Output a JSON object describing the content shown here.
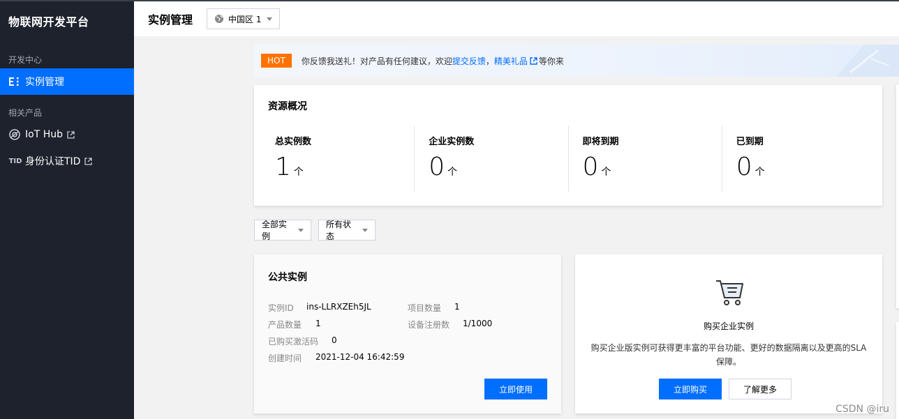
{
  "sidebar": {
    "brand": "物联网开发平台",
    "group1": "开发中心",
    "items": [
      {
        "label": "实例管理",
        "icon": "list-icon"
      }
    ],
    "group2": "相关产品",
    "related": [
      {
        "label": "IoT Hub",
        "icon": "iot-hub-icon"
      },
      {
        "label": "身份认证TID",
        "icon": "tid-icon",
        "icon_text": "TID"
      }
    ]
  },
  "header": {
    "title": "实例管理",
    "region": "中国区 1"
  },
  "notice": {
    "badge": "HOT",
    "text": "你反馈我送礼！对产品有任何建议，欢迎",
    "link1": "提交反馈",
    "sep": "，",
    "link2": "精美礼品",
    "tail": "等你来"
  },
  "overview": {
    "title": "资源概况",
    "stats": [
      {
        "label": "总实例数",
        "value": "1",
        "unit": "个"
      },
      {
        "label": "企业实例数",
        "value": "0",
        "unit": "个"
      },
      {
        "label": "即将到期",
        "value": "0",
        "unit": "个"
      },
      {
        "label": "已到期",
        "value": "0",
        "unit": "个"
      }
    ]
  },
  "filters": {
    "instance": "全部实例",
    "status": "所有状态"
  },
  "public_instance": {
    "title": "公共实例",
    "instance_id_label": "实例ID",
    "instance_id": "ins-LLRXZEh5JL",
    "project_count_label": "项目数量",
    "project_count": "1",
    "product_count_label": "产品数量",
    "product_count": "1",
    "device_reg_label": "设备注册数",
    "device_reg": "1/1000",
    "activation_label": "已购买激活码",
    "activation": "0",
    "created_label": "创建时间",
    "created": "2021-12-04 16:42:59",
    "use_button": "立即使用"
  },
  "buy_card": {
    "title": "购买企业实例",
    "desc": "购买企业版实例可获得更丰富的平台功能、更好的数据隔离以及更高的SLA保障。",
    "buy_button": "立即购买",
    "learn_button": "了解更多"
  },
  "watermark": "CSDN @iru",
  "colors": {
    "accent": "#006eff",
    "sidebar_bg": "#1e222d",
    "hot": "#ff7200"
  }
}
